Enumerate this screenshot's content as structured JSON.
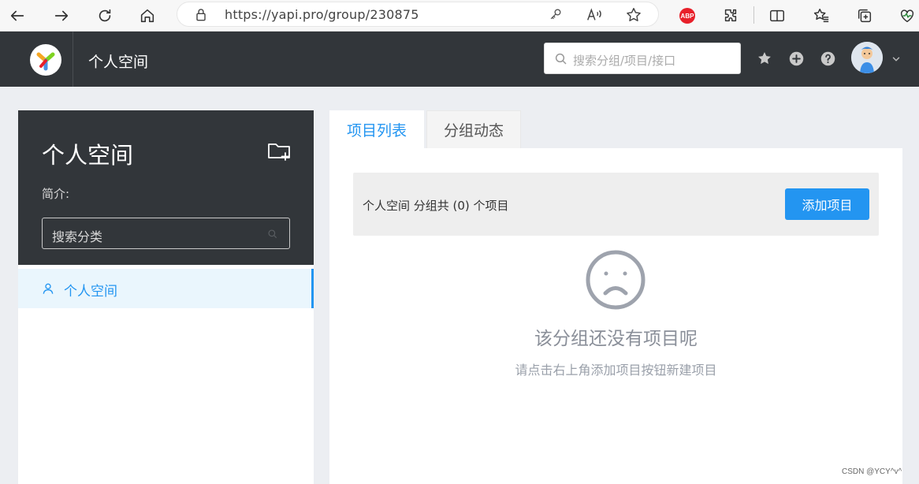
{
  "browser": {
    "url": "https://yapi.pro/group/230875",
    "adblock_label": "ABP"
  },
  "header": {
    "title": "个人空间",
    "search_placeholder": "搜索分组/项目/接口"
  },
  "sidebar": {
    "title": "个人空间",
    "description_label": "简介:",
    "search_placeholder": "搜索分类",
    "items": [
      {
        "label": "个人空间",
        "active": true
      }
    ]
  },
  "tabs": [
    {
      "label": "项目列表",
      "active": true
    },
    {
      "label": "分组动态",
      "active": false
    }
  ],
  "main": {
    "summary": "个人空间 分组共 (0) 个项目",
    "add_button": "添加项目",
    "empty_title": "该分组还没有项目呢",
    "empty_subtitle": "请点击右上角添加项目按钮新建项目"
  },
  "watermark": "CSDN @YCY^v^",
  "colors": {
    "accent": "#2395f1",
    "header_bg": "#32363a",
    "page_bg": "#eceef2",
    "abp_red": "#e8202a"
  },
  "icons": [
    "back-icon",
    "forward-icon",
    "refresh-icon",
    "home-icon",
    "lock-icon",
    "key-icon",
    "read-aloud-icon",
    "star-icon",
    "extensions-icon",
    "split-screen-icon",
    "favorites-icon",
    "collections-icon",
    "performance-icon",
    "search-icon",
    "star-filled-icon",
    "plus-circle-icon",
    "help-icon",
    "avatar",
    "chevron-down-icon",
    "folder-add-icon",
    "user-icon",
    "sad-face-icon"
  ]
}
